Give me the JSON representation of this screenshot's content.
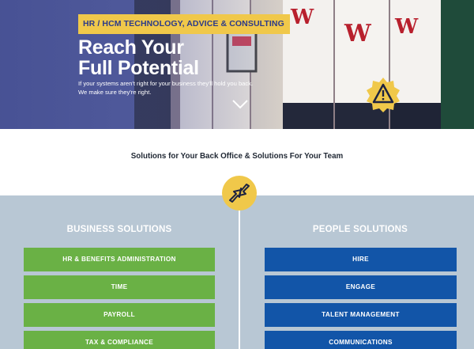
{
  "hero": {
    "tag": "HR / HCM TECHNOLOGY, ADVICE & CONSULTING",
    "title_line1": "Reach Your",
    "title_line2": "Full Potential",
    "sub_line1": "If your systems aren't right for your business they'll hold you back.",
    "sub_line2": "We make sure they're right.",
    "scroll_icon": "chevron-down-icon",
    "badge_icon": "alert-badge-icon"
  },
  "section": {
    "heading": "Solutions for Your Back Office & Solutions For Your Team",
    "center_icon": "arrows-badge-icon"
  },
  "business": {
    "title": "BUSINESS SOLUTIONS",
    "items": [
      "HR & BENEFITS ADMINISTRATION",
      "TIME",
      "PAYROLL",
      "TAX & COMPLIANCE"
    ]
  },
  "people": {
    "title": "PEOPLE SOLUTIONS",
    "items": [
      "HIRE",
      "ENGAGE",
      "TALENT MANAGEMENT",
      "COMMUNICATIONS"
    ]
  },
  "colors": {
    "accent_yellow": "#f0c84a",
    "brand_blue": "#2b3a8a",
    "green": "#6ab145",
    "blue": "#1255a8",
    "panel": "#b8c7d4"
  }
}
